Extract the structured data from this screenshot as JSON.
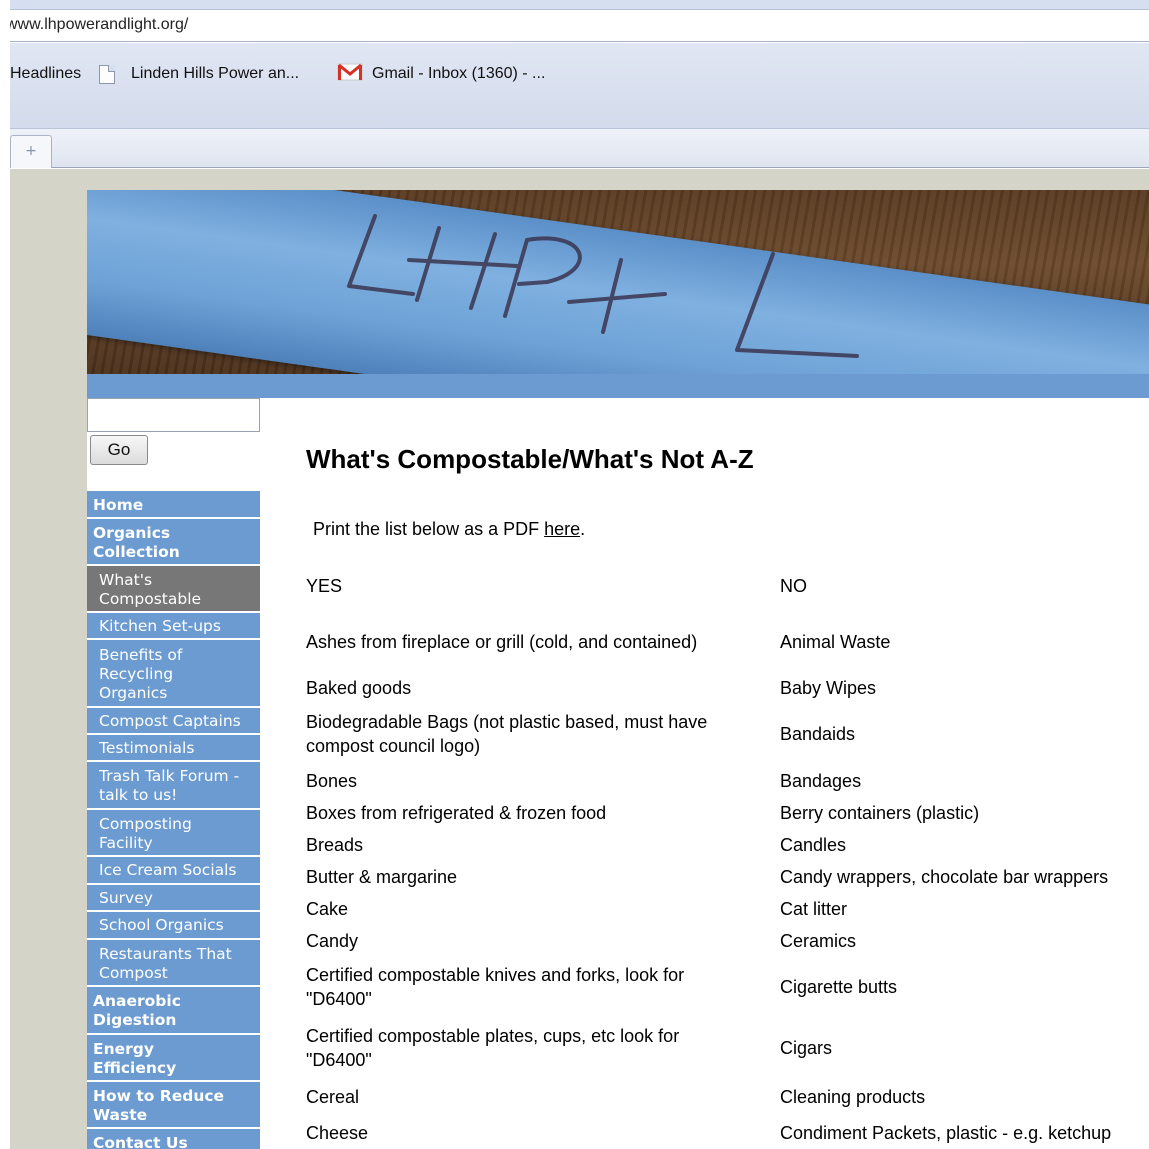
{
  "browser": {
    "url": "www.lhpowerandlight.org/",
    "bookmarks": [
      {
        "label": "Headlines"
      },
      {
        "label": "Linden Hills Power an..."
      },
      {
        "label": "Gmail - Inbox (1360) - ..."
      }
    ],
    "new_tab_symbol": "+"
  },
  "banner": {
    "tape_text": "LHP+L"
  },
  "sidebar": {
    "go_label": "Go",
    "nav": [
      {
        "label": "Home",
        "level": "top"
      },
      {
        "label": "Organics Collection",
        "level": "top"
      },
      {
        "label": "What's Compostable",
        "level": "sub",
        "active": true
      },
      {
        "label": "Kitchen Set-ups",
        "level": "sub"
      },
      {
        "label": "Benefits of Recycling Organics",
        "level": "sub"
      },
      {
        "label": "Compost Captains",
        "level": "sub"
      },
      {
        "label": "Testimonials",
        "level": "sub"
      },
      {
        "label": "Trash Talk Forum -talk to us!",
        "level": "sub"
      },
      {
        "label": "Composting Facility",
        "level": "sub"
      },
      {
        "label": "Ice Cream Socials",
        "level": "sub"
      },
      {
        "label": "Survey",
        "level": "sub"
      },
      {
        "label": "School Organics",
        "level": "sub"
      },
      {
        "label": "Restaurants That Compost",
        "level": "sub"
      },
      {
        "label": "Anaerobic Digestion",
        "level": "top"
      },
      {
        "label": "Energy Efficiency",
        "level": "top"
      },
      {
        "label": "How to Reduce Waste",
        "level": "top"
      },
      {
        "label": "Contact Us",
        "level": "top"
      }
    ]
  },
  "main": {
    "title": "What's Compostable/What's Not A-Z",
    "print_prefix": "Print the list below as a PDF ",
    "print_link": "here",
    "print_suffix": ".",
    "yes_header": "YES",
    "no_header": "NO",
    "rows": [
      {
        "yes": "Ashes from fireplace or grill (cold, and contained)",
        "no": "Animal Waste"
      },
      {
        "yes": "Baked goods",
        "no": "Baby Wipes"
      },
      {
        "yes": "Biodegradable Bags (not plastic based, must have compost council logo)",
        "no": "Bandaids"
      },
      {
        "yes": "Bones",
        "no": "Bandages"
      },
      {
        "yes": "Boxes from refrigerated & frozen food",
        "no": "Berry containers (plastic)"
      },
      {
        "yes": "Breads",
        "no": "Candles"
      },
      {
        "yes": "Butter & margarine",
        "no": "Candy wrappers, chocolate bar wrappers"
      },
      {
        "yes": "Cake",
        "no": "Cat litter"
      },
      {
        "yes": "Candy",
        "no": "Ceramics"
      },
      {
        "yes": "Certified compostable knives and forks, look for \"D6400\"",
        "no": "Cigarette butts"
      },
      {
        "yes": "Certified compostable plates, cups, etc look for \"D6400\"",
        "no": "Cigars"
      },
      {
        "yes": "Cereal",
        "no": "Cleaning products"
      },
      {
        "yes": "Cheese",
        "no": "Condiment Packets, plastic - e.g. ketchup"
      }
    ]
  }
}
